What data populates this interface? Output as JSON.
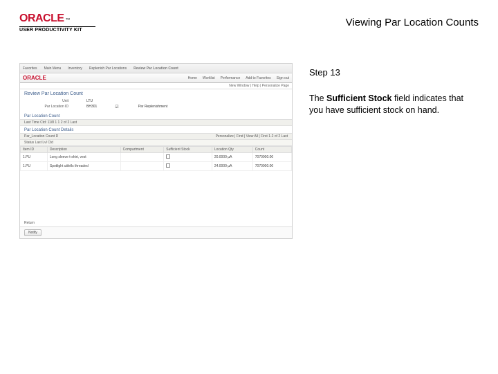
{
  "logo": {
    "brand": "ORACLE",
    "tm": "™",
    "subtitle": "USER PRODUCTIVITY KIT"
  },
  "page_title": "Viewing Par Location Counts",
  "step_label": "Step 13",
  "desc_pre": "The ",
  "desc_bold": "Sufficient Stock",
  "desc_post": " field indicates that you have sufficient stock on hand.",
  "ss": {
    "top": {
      "left": [
        "Favorites",
        "Main Menu",
        "Inventory",
        "Replenish Par Locations",
        "Review Par Location Count"
      ],
      "right": [
        "Home",
        "Worklist",
        "Performance Trace",
        "Add to Favorites",
        "Sign out"
      ]
    },
    "brand": "ORACLE",
    "menus": [
      "Home",
      "Worklist",
      "Performance",
      "Add to Favorites",
      "Sign out"
    ],
    "subbar": "New Window | Help | Personalize Page",
    "title": "Review Par Location Count",
    "info": [
      {
        "lbl": "Unit",
        "val": "LTU"
      },
      {
        "lbl": "Par Location ID",
        "val": "BH301",
        "lbl2": "Par Replenishment"
      },
      {
        "lbl": "",
        "val": ""
      }
    ],
    "countLbl": "Par Location Count",
    "countInfo": "Last Time Ctd:    11/8    1 1    2 of 2    Last",
    "detailsLbl": "Par Location Count Details",
    "findbar": {
      "left": "Par_Location Count D",
      "right": "Personalize | Find | View All |    First  1-2 of 2  Last"
    },
    "findbar2": "Status    Last Lvl Ctd",
    "headers": [
      "Item ID",
      "Description",
      "Compartment",
      "Sufficient Stock",
      "Location Qty",
      "Count"
    ],
    "rows": [
      {
        "item": "1.PU",
        "desc": "Long sleeve t-shirt, vest",
        "comp": "",
        "ss": true,
        "qty": "20.0000 µA",
        "cnt": "7070000.00"
      },
      {
        "item": "1.PU",
        "desc": "Spotlight utilells threaded",
        "comp": "",
        "ss": true,
        "qty": "24.0000 µA",
        "cnt": "7070000.00"
      }
    ],
    "return": "Return",
    "notify": "Notify"
  }
}
